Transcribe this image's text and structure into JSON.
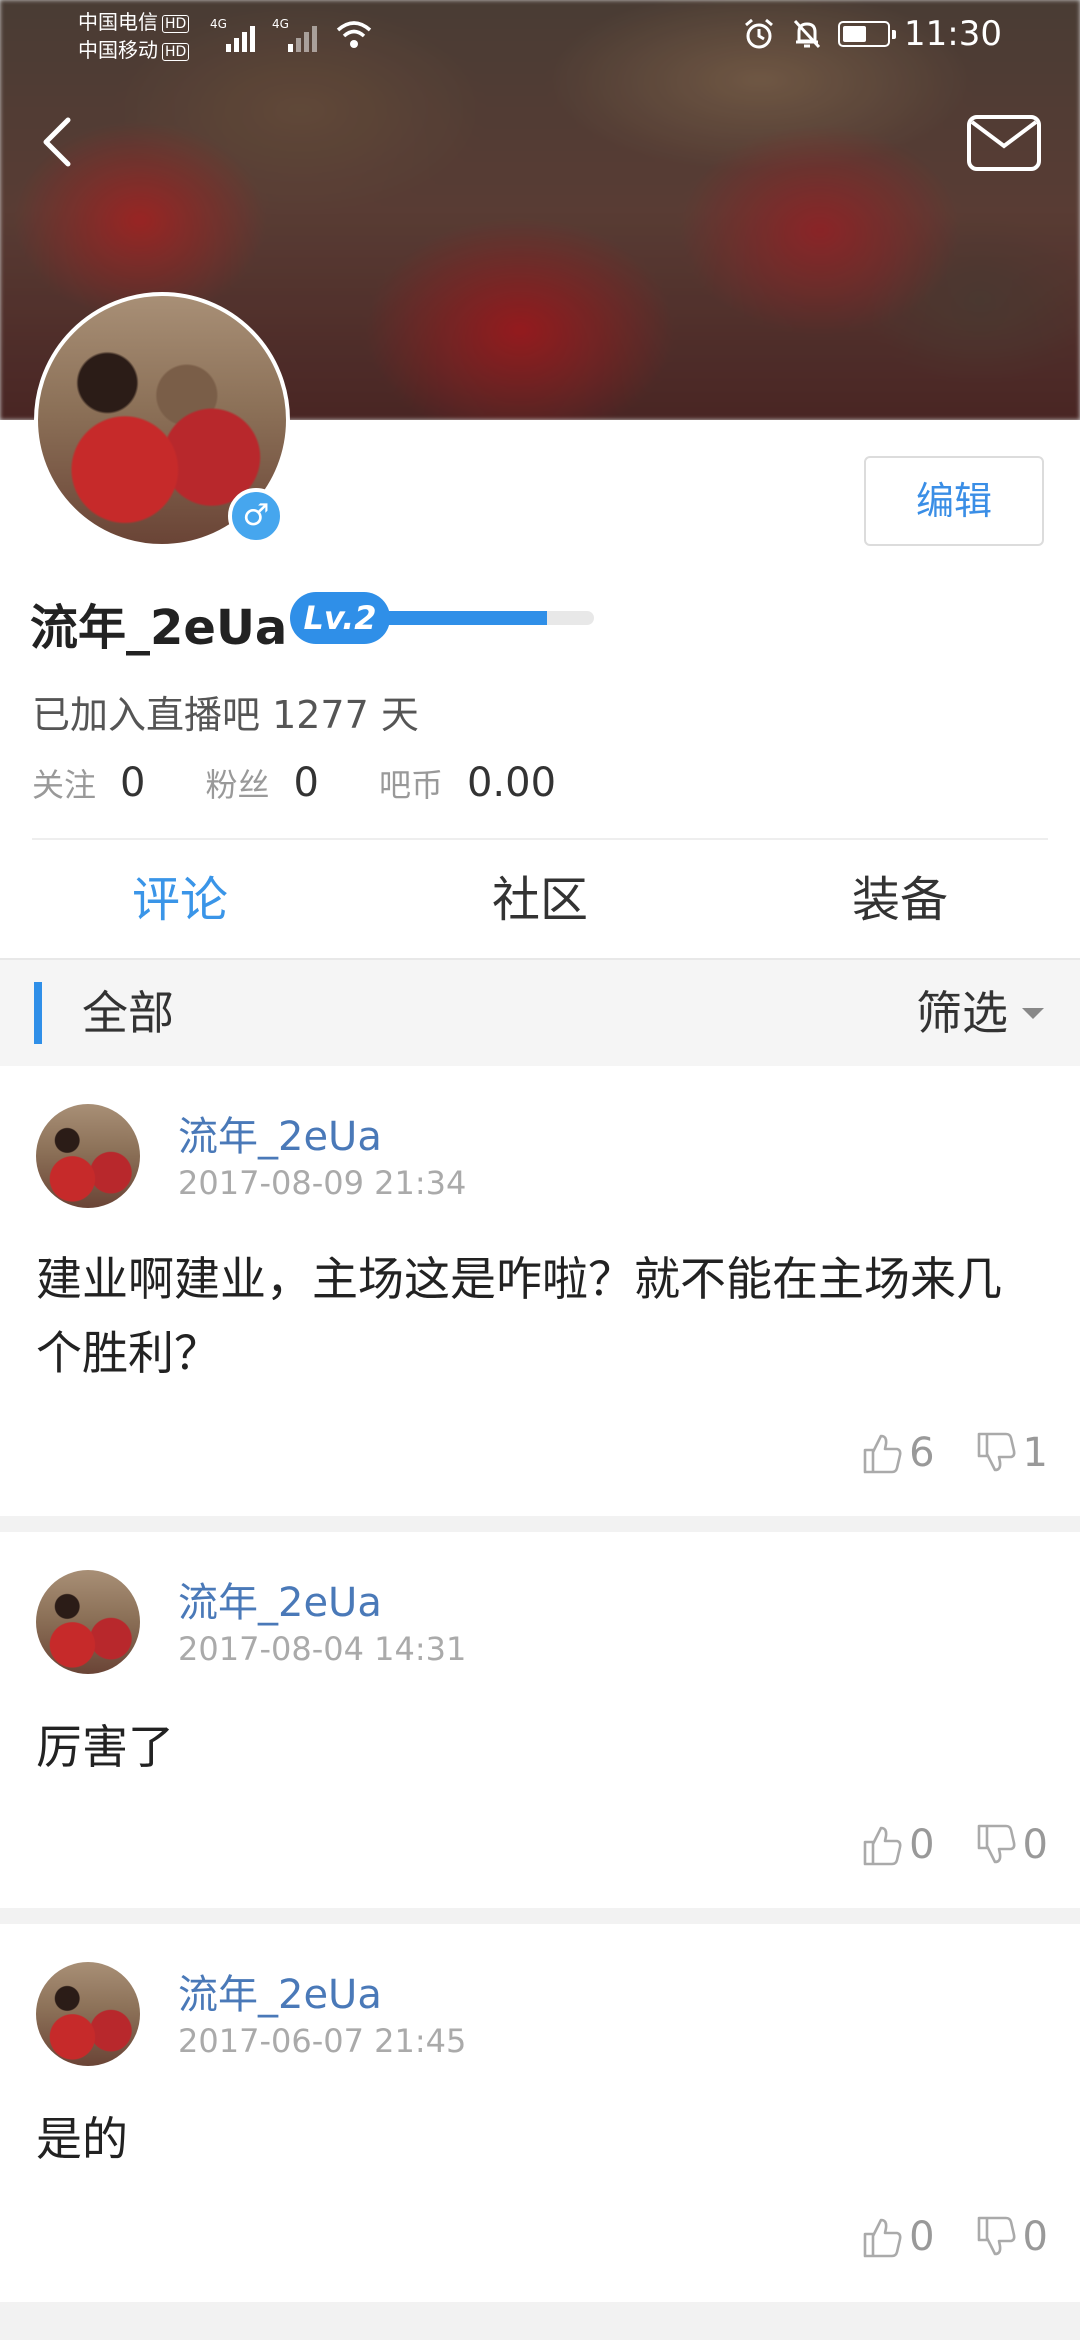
{
  "status_bar": {
    "carrier1": "中国电信",
    "carrier2": "中国移动",
    "hd": "HD",
    "network": "4G",
    "time": "11:30",
    "battery_level": 0.55
  },
  "header": {
    "back_icon": "chevron-left-icon",
    "mail_icon": "envelope-icon"
  },
  "profile": {
    "username": "流年_2eUa",
    "gender": "♂",
    "level": "Lv.2",
    "level_progress": 0.78,
    "edit_label": "编辑",
    "joined_text": "已加入直播吧 1277 天",
    "stats": [
      {
        "label": "关注",
        "value": "0"
      },
      {
        "label": "粉丝",
        "value": "0"
      },
      {
        "label": "吧币",
        "value": "0.00"
      }
    ]
  },
  "tabs": [
    {
      "label": "评论",
      "active": true
    },
    {
      "label": "社区",
      "active": false
    },
    {
      "label": "装备",
      "active": false
    }
  ],
  "filter": {
    "title": "全部",
    "select_label": "筛选"
  },
  "comments": [
    {
      "name": "流年_2eUa",
      "time": "2017-08-09 21:34",
      "body": "建业啊建业，主场这是咋啦？就不能在主场来几个胜利？",
      "likes": "6",
      "dislikes": "1"
    },
    {
      "name": "流年_2eUa",
      "time": "2017-08-04 14:31",
      "body": "厉害了",
      "likes": "0",
      "dislikes": "0"
    },
    {
      "name": "流年_2eUa",
      "time": "2017-06-07 21:45",
      "body": "是的",
      "likes": "0",
      "dislikes": "0"
    }
  ],
  "colors": {
    "accent": "#2f8fe8",
    "name_link": "#4a79b8"
  }
}
